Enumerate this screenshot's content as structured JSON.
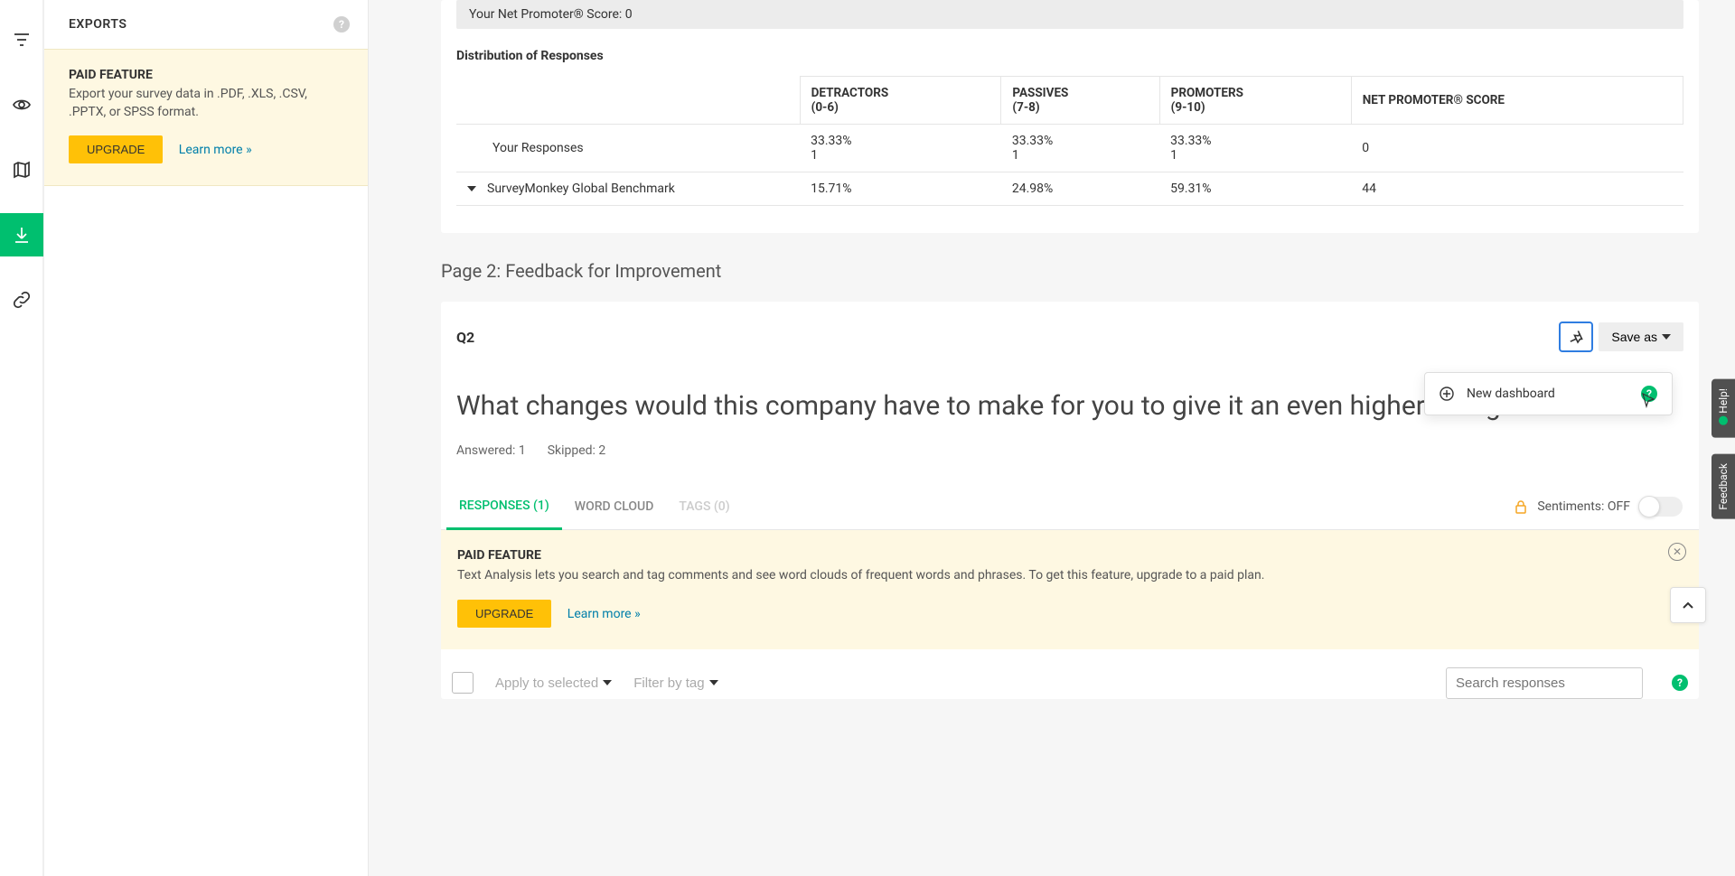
{
  "rail": {
    "items": [
      "filter",
      "eye",
      "map-pin",
      "download",
      "link"
    ],
    "active_index": 3
  },
  "sidebar": {
    "title": "EXPORTS",
    "promo": {
      "paid_label": "PAID FEATURE",
      "desc": "Export your survey data in .PDF, .XLS, .CSV, .PPTX, or SPSS format.",
      "upgrade_label": "UPGRADE",
      "learn_more": "Learn more »"
    }
  },
  "q1": {
    "nps_label": "Your Net Promoter® Score: 0",
    "dist_title": "Distribution of Responses",
    "columns": {
      "c0": "",
      "c1": "DETRACTORS",
      "c1b": "(0-6)",
      "c2": "PASSIVES",
      "c2b": "(7-8)",
      "c3": "PROMOTERS",
      "c3b": "(9-10)",
      "c4": "NET PROMOTER® SCORE"
    },
    "row1": {
      "label": "Your Responses",
      "detr_pct": "33.33%",
      "detr_n": "1",
      "pass_pct": "33.33%",
      "pass_n": "1",
      "prom_pct": "33.33%",
      "prom_n": "1",
      "score": "0"
    },
    "row2": {
      "label": "SurveyMonkey Global Benchmark",
      "detr": "15.71%",
      "pass": "24.98%",
      "prom": "59.31%",
      "score": "44"
    }
  },
  "page2": {
    "heading": "Page 2: Feedback for Improvement"
  },
  "q2": {
    "number": "Q2",
    "saveas": "Save as",
    "dropdown_item": "New dashboard",
    "text": "What changes would this company have to make for you to give it an even higher rating?",
    "answered": "Answered: 1",
    "skipped": "Skipped: 2",
    "tabs": {
      "responses": "RESPONSES (1)",
      "wordcloud": "WORD CLOUD",
      "tags": "TAGS (0)"
    },
    "sentiments_label": "Sentiments: OFF",
    "promo": {
      "paid_label": "PAID FEATURE",
      "desc": "Text Analysis lets you search and tag comments and see word clouds of frequent words and phrases. To get this feature, upgrade to a paid plan.",
      "upgrade_label": "UPGRADE",
      "learn_more": "Learn more »"
    },
    "toolbar": {
      "apply": "Apply to selected",
      "filter": "Filter by tag",
      "search_placeholder": "Search responses"
    }
  },
  "help_tab": "Help!",
  "feedback_tab": "Feedback"
}
